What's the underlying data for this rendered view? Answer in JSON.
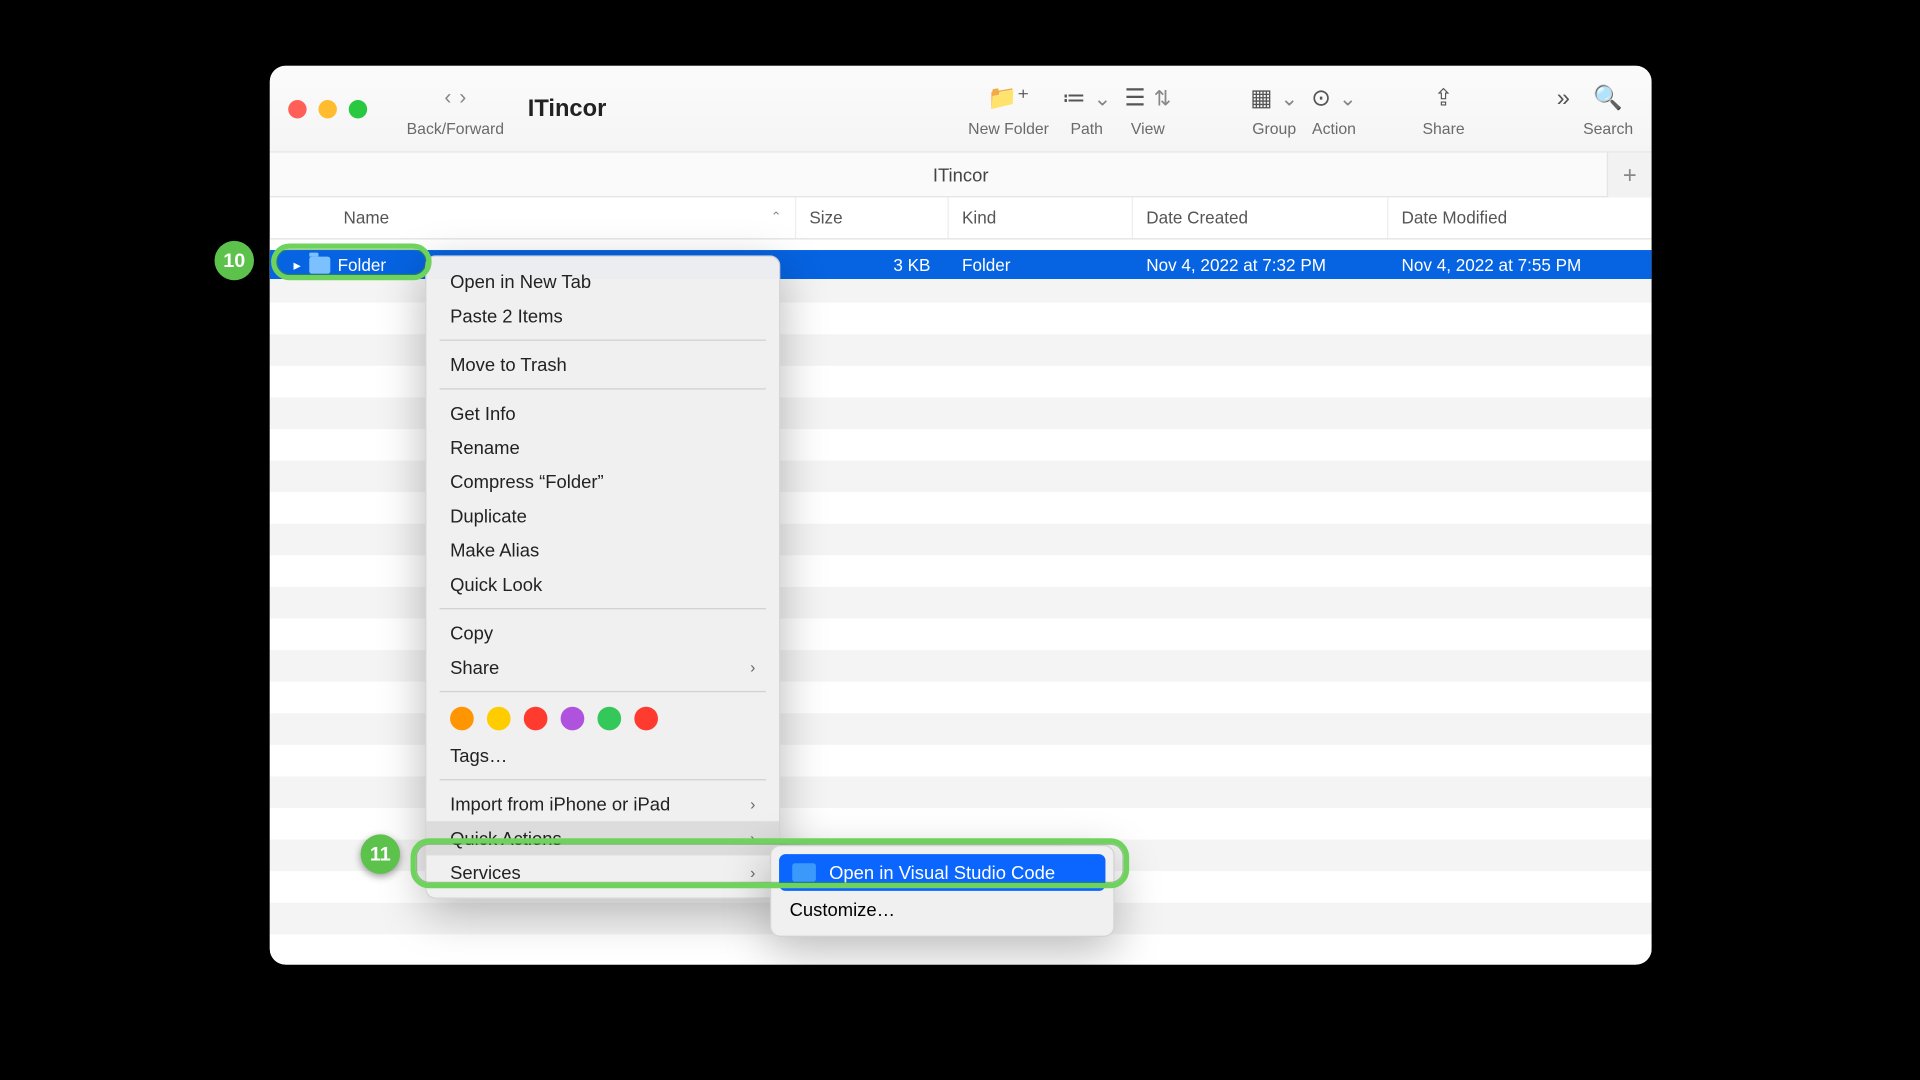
{
  "window": {
    "title": "ITincor",
    "path_title": "ITincor"
  },
  "toolbar": {
    "back_forward": "Back/Forward",
    "new_folder": "New Folder",
    "path": "Path",
    "view": "View",
    "group": "Group",
    "action": "Action",
    "share": "Share",
    "search": "Search"
  },
  "columns": {
    "name": "Name",
    "size": "Size",
    "kind": "Kind",
    "created": "Date Created",
    "modified": "Date Modified"
  },
  "row": {
    "name": "Folder",
    "size": "3 KB",
    "kind": "Folder",
    "created": "Nov 4, 2022 at 7:32 PM",
    "modified": "Nov 4, 2022 at 7:55 PM"
  },
  "ctx": {
    "open_new_tab": "Open in New Tab",
    "paste": "Paste 2 Items",
    "trash": "Move to Trash",
    "get_info": "Get Info",
    "rename": "Rename",
    "compress": "Compress “Folder”",
    "duplicate": "Duplicate",
    "make_alias": "Make Alias",
    "quick_look": "Quick Look",
    "copy": "Copy",
    "share": "Share",
    "tags": "Tags…",
    "import": "Import from iPhone or iPad",
    "quick_actions": "Quick Actions",
    "services": "Services"
  },
  "tag_colors": [
    "#ff9500",
    "#ffcc00",
    "#ff3b30",
    "#af52de",
    "#34c759",
    "#ff3b30"
  ],
  "submenu": {
    "open_vscode": "Open in Visual Studio Code",
    "customize": "Customize…"
  },
  "callouts": {
    "b10": "10",
    "b11": "11"
  }
}
